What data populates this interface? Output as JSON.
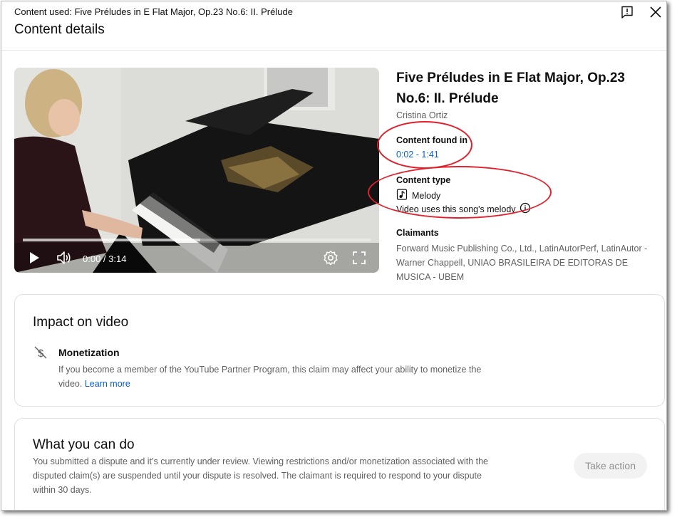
{
  "header": {
    "content_used": "Content used: Five Préludes in E Flat Major, Op.23 No.6: II. Prélude",
    "title": "Content details",
    "icons": [
      "feedback-icon",
      "close-icon"
    ]
  },
  "player": {
    "time": "0:00 / 3:14",
    "progress_played_fraction": 0.0,
    "icons": [
      "play-icon",
      "volume-icon",
      "settings-icon",
      "fullscreen-icon"
    ]
  },
  "song": {
    "title": "Five Préludes in E Flat Major, Op.23 No.6: II. Prélude",
    "artist": "Cristina Ortiz",
    "content_found_label": "Content found in",
    "content_found_value": "0:02 - 1:41",
    "content_type_label": "Content type",
    "content_type_value": "Melody",
    "content_type_desc": "Video uses this song's melody",
    "claimants_label": "Claimants",
    "claimants_value": "Forward Music Publishing Co., Ltd., LatinAutorPerf, LatinAutor - Warner Chappell, UNIAO BRASILEIRA DE EDITORAS DE MUSICA - UBEM"
  },
  "impact": {
    "title": "Impact on video",
    "monetization_title": "Monetization",
    "monetization_desc": "If you become a member of the YouTube Partner Program, this claim may affect your ability to monetize the video.",
    "learn_more": "Learn more"
  },
  "todo": {
    "title": "What you can do",
    "desc": "You submitted a dispute and it’s currently under review. Viewing restrictions and/or monetization associated with the disputed claim(s) are suspended until your dispute is resolved. The claimant is required to respond to your dispute within 30 days.",
    "action_label": "Take action"
  },
  "colors": {
    "link": "#065fd4",
    "annotation": "#e0212b",
    "muted": "#606060"
  }
}
